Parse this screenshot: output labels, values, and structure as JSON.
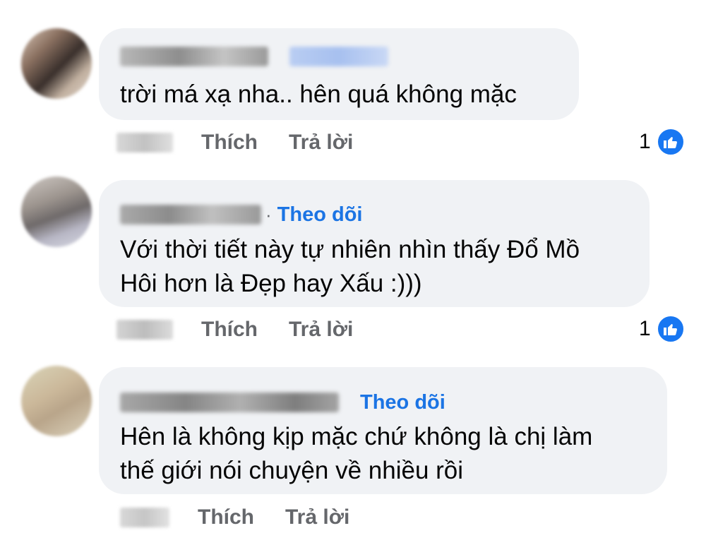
{
  "comments": [
    {
      "follow_label": "",
      "text_lines": [
        "trời má xạ nha.. hên quá không mặc"
      ],
      "like_label": "Thích",
      "reply_label": "Trả lời",
      "reaction_count": "1"
    },
    {
      "follow_label": "Theo dõi",
      "text_lines": [
        "Với thời tiết này tự nhiên nhìn thấy Đổ Mồ",
        "Hôi hơn là Đẹp hay Xấu :)))"
      ],
      "like_label": "Thích",
      "reply_label": "Trả lời",
      "reaction_count": "1"
    },
    {
      "follow_label": "Theo dõi",
      "text_lines": [
        "Hên là không kịp mặc chứ không là chị làm",
        "thế giới nói chuyện về nhiều rồi"
      ],
      "like_label": "Thích",
      "reply_label": "Trả lời",
      "reaction_count": ""
    }
  ],
  "colors": {
    "bubble": "#f0f2f5",
    "link": "#1b74e4",
    "secondary_text": "#65676b",
    "like_blue": "#1877f2"
  },
  "icons": [
    "thumbs-up-icon"
  ]
}
